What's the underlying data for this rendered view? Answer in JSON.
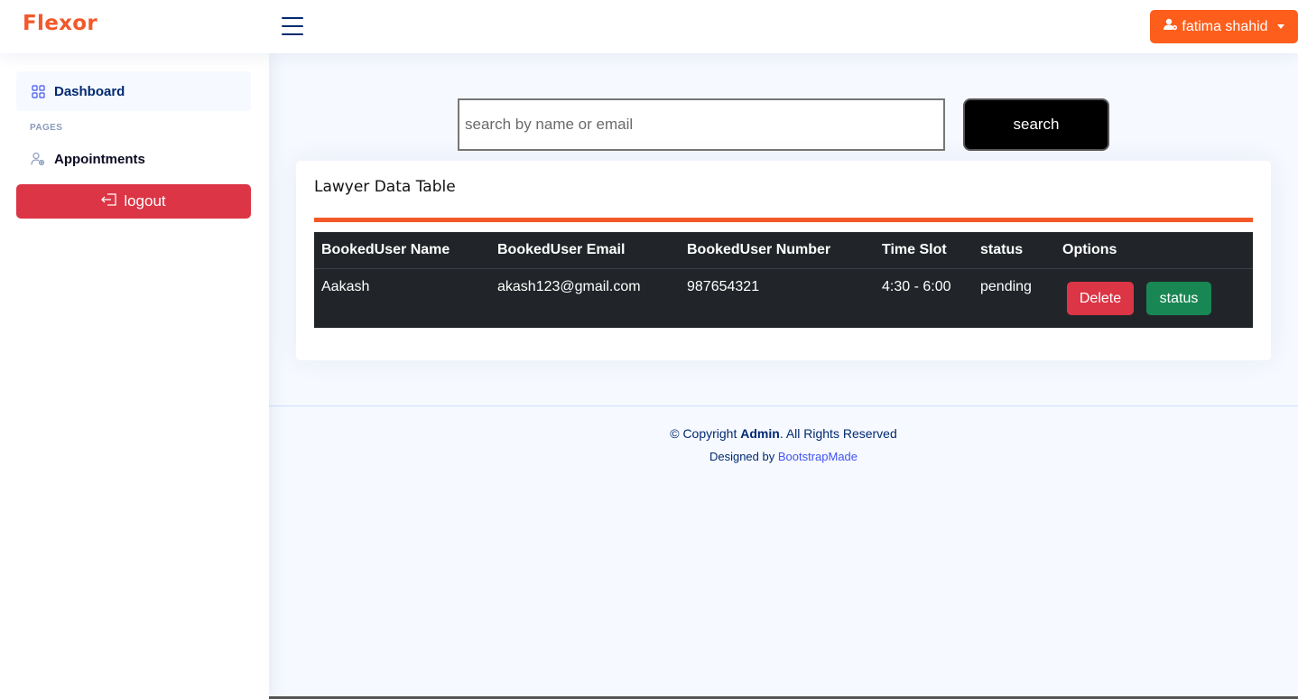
{
  "header": {
    "logo": "Flexor",
    "user_name": "fatima shahid"
  },
  "sidebar": {
    "dashboard_label": "Dashboard",
    "section_heading": "PAGES",
    "appointments_label": "Appointments",
    "logout_label": "logout"
  },
  "search": {
    "placeholder": "search by name or email",
    "value": "",
    "button_label": "search"
  },
  "table_card": {
    "title": "Lawyer Data Table",
    "columns": [
      "BookedUser Name",
      "BookedUser Email",
      "BookedUser Number",
      "Time Slot",
      "status",
      "Options"
    ],
    "rows": [
      {
        "name": "Aakash",
        "email": "akash123@gmail.com",
        "number": "987654321",
        "time_slot": "4:30 - 6:00",
        "status": "pending",
        "delete_label": "Delete",
        "status_label": "status"
      }
    ]
  },
  "footer": {
    "copyright_prefix": "© Copyright",
    "copyright_owner": "Admin",
    "copyright_suffix": ". All Rights Reserved",
    "designed_by": "Designed by",
    "designer": "BootstrapMade"
  },
  "colors": {
    "brand": "#f2582a",
    "user_button": "#fd5e1c",
    "danger": "#dc3545",
    "success": "#198754",
    "table_dark": "#212529",
    "navy": "#012970"
  }
}
